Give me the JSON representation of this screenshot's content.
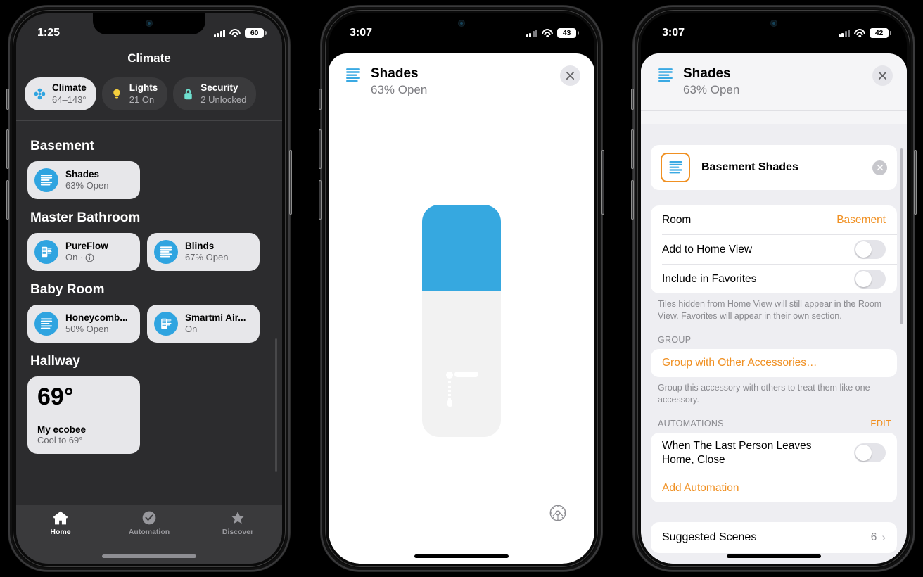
{
  "colors": {
    "accent_blue": "#2fa4e0",
    "accent_orange": "#f09022",
    "slider_blue": "#36a8e0",
    "tile_bg": "#e7e7ea",
    "dark_bg": "#2c2c2e"
  },
  "phone1": {
    "status": {
      "time": "1:25",
      "battery": "60",
      "signal_bars": 4,
      "wifi": "wifi-icon"
    },
    "title": "Climate",
    "chips": [
      {
        "label": "Climate",
        "sub": "64–143°",
        "icon": "fan-icon",
        "active": true
      },
      {
        "label": "Lights",
        "sub": "21 On",
        "icon": "lightbulb-icon",
        "active": false
      },
      {
        "label": "Security",
        "sub": "2 Unlocked",
        "icon": "lock-icon",
        "active": false
      }
    ],
    "rooms": [
      {
        "name": "Basement",
        "tiles": [
          {
            "name": "Shades",
            "status": "63% Open",
            "icon": "blinds-icon",
            "info": false
          }
        ]
      },
      {
        "name": "Master Bathroom",
        "tiles": [
          {
            "name": "PureFlow",
            "status": "On ·",
            "icon": "air-purifier-icon",
            "info": true
          },
          {
            "name": "Blinds",
            "status": "67% Open",
            "icon": "blinds-icon",
            "info": false
          }
        ]
      },
      {
        "name": "Baby Room",
        "tiles": [
          {
            "name": "Honeycomb...",
            "status": "50% Open",
            "icon": "blinds-icon",
            "info": false
          },
          {
            "name": "Smartmi Air...",
            "status": "On",
            "icon": "air-purifier-icon",
            "info": false
          }
        ]
      }
    ],
    "hallway": {
      "name": "Hallway",
      "temp": "69°",
      "device": "My ecobee",
      "status": "Cool to 69°"
    },
    "tabs": [
      {
        "label": "Home",
        "icon": "house-icon",
        "active": true
      },
      {
        "label": "Automation",
        "icon": "clock-check-icon",
        "active": false
      },
      {
        "label": "Discover",
        "icon": "star-icon",
        "active": false
      }
    ]
  },
  "phone2": {
    "status": {
      "time": "3:07",
      "battery": "43",
      "signal_bars": 2,
      "wifi": "wifi-icon"
    },
    "header": {
      "title": "Shades",
      "subtitle": "63% Open",
      "icon": "blinds-icon",
      "close": "close-icon"
    },
    "slider": {
      "percent_open": 63,
      "fill_percent": 37,
      "marker": "shade-position-marker"
    },
    "settings_icon": "gear-icon"
  },
  "phone3": {
    "status": {
      "time": "3:07",
      "battery": "42",
      "signal_bars": 2,
      "wifi": "wifi-icon"
    },
    "header": {
      "title": "Shades",
      "subtitle": "63% Open",
      "icon": "blinds-icon",
      "close": "close-icon"
    },
    "accessory": {
      "name": "Basement Shades",
      "icon": "blinds-icon",
      "remove": "remove-icon"
    },
    "rows": [
      {
        "label": "Room",
        "value": "Basement",
        "type": "value"
      },
      {
        "label": "Add to Home View",
        "type": "toggle",
        "on": false
      },
      {
        "label": "Include in Favorites",
        "type": "toggle",
        "on": false
      }
    ],
    "footnote": "Tiles hidden from Home View will still appear in the Room View. Favorites will appear in their own section.",
    "group": {
      "header": "GROUP",
      "link": "Group with Other Accessories…",
      "footnote": "Group this accessory with others to treat them like one accessory."
    },
    "automations": {
      "header": "AUTOMATIONS",
      "edit": "EDIT",
      "items": [
        {
          "label": "When The Last Person Leaves Home, Close",
          "type": "toggle",
          "on": false
        }
      ],
      "add": "Add Automation"
    },
    "scenes": {
      "label": "Suggested Scenes",
      "count": "6",
      "chevron": "chevron-right-icon"
    }
  }
}
